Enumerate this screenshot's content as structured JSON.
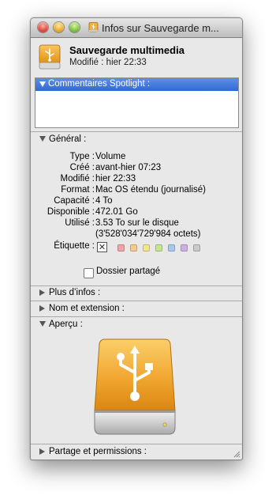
{
  "window": {
    "title": "Infos sur Sauvegarde m..."
  },
  "header": {
    "name": "Sauvegarde multimedia",
    "modified_label": "Modifié :",
    "modified_value": "hier 22:33"
  },
  "spotlight": {
    "label": "Commentaires Spotlight :"
  },
  "general": {
    "label": "Général :",
    "rows": [
      {
        "key": "Type :",
        "value": "Volume"
      },
      {
        "key": "Créé :",
        "value": "avant-hier 07:23"
      },
      {
        "key": "Modifié :",
        "value": "hier 22:33"
      },
      {
        "key": "Format :",
        "value": "Mac OS étendu (journalisé)"
      },
      {
        "key": "Capacité :",
        "value": "4 To"
      },
      {
        "key": "Disponible :",
        "value": "472.01 Go"
      },
      {
        "key": "Utilisé :",
        "value": "3.53 To sur le disque"
      },
      {
        "key": "",
        "value": "(3'528'034'729'984 octets)"
      }
    ],
    "label_field": "Étiquette :",
    "label_colors": [
      "#f2a3a3",
      "#f7c98a",
      "#f2e58c",
      "#c5e58f",
      "#a8c8f2",
      "#d2aee8",
      "#c9c9c9"
    ],
    "shared_folder": "Dossier partagé"
  },
  "sections": {
    "more_info": "Plus d’infos :",
    "name_ext": "Nom et extension :",
    "preview": "Aperçu :",
    "sharing": "Partage et permissions :"
  }
}
